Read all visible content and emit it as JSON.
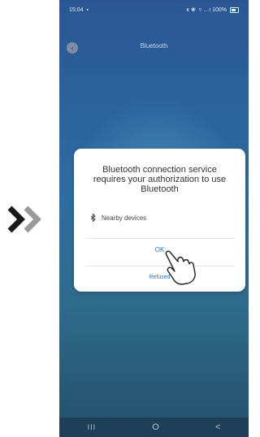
{
  "status_bar": {
    "time": "15:04",
    "right_text": "ĸ ❀  ▿ …ı 100%"
  },
  "header": {
    "title": "Bluetooth",
    "back_icon": "back-arrow-icon"
  },
  "dialog": {
    "title": "Bluetooth connection service requires your authorization to use Bluetooth",
    "permission_label": "Nearby devices",
    "ok_label": "OK",
    "refuse_label": "Refused"
  },
  "nav": {
    "recents": "III",
    "home": "O",
    "back": "<"
  },
  "colors": {
    "accent": "#1b7ad6",
    "background_top": "#2a5794",
    "background_bottom": "#234f6a"
  }
}
